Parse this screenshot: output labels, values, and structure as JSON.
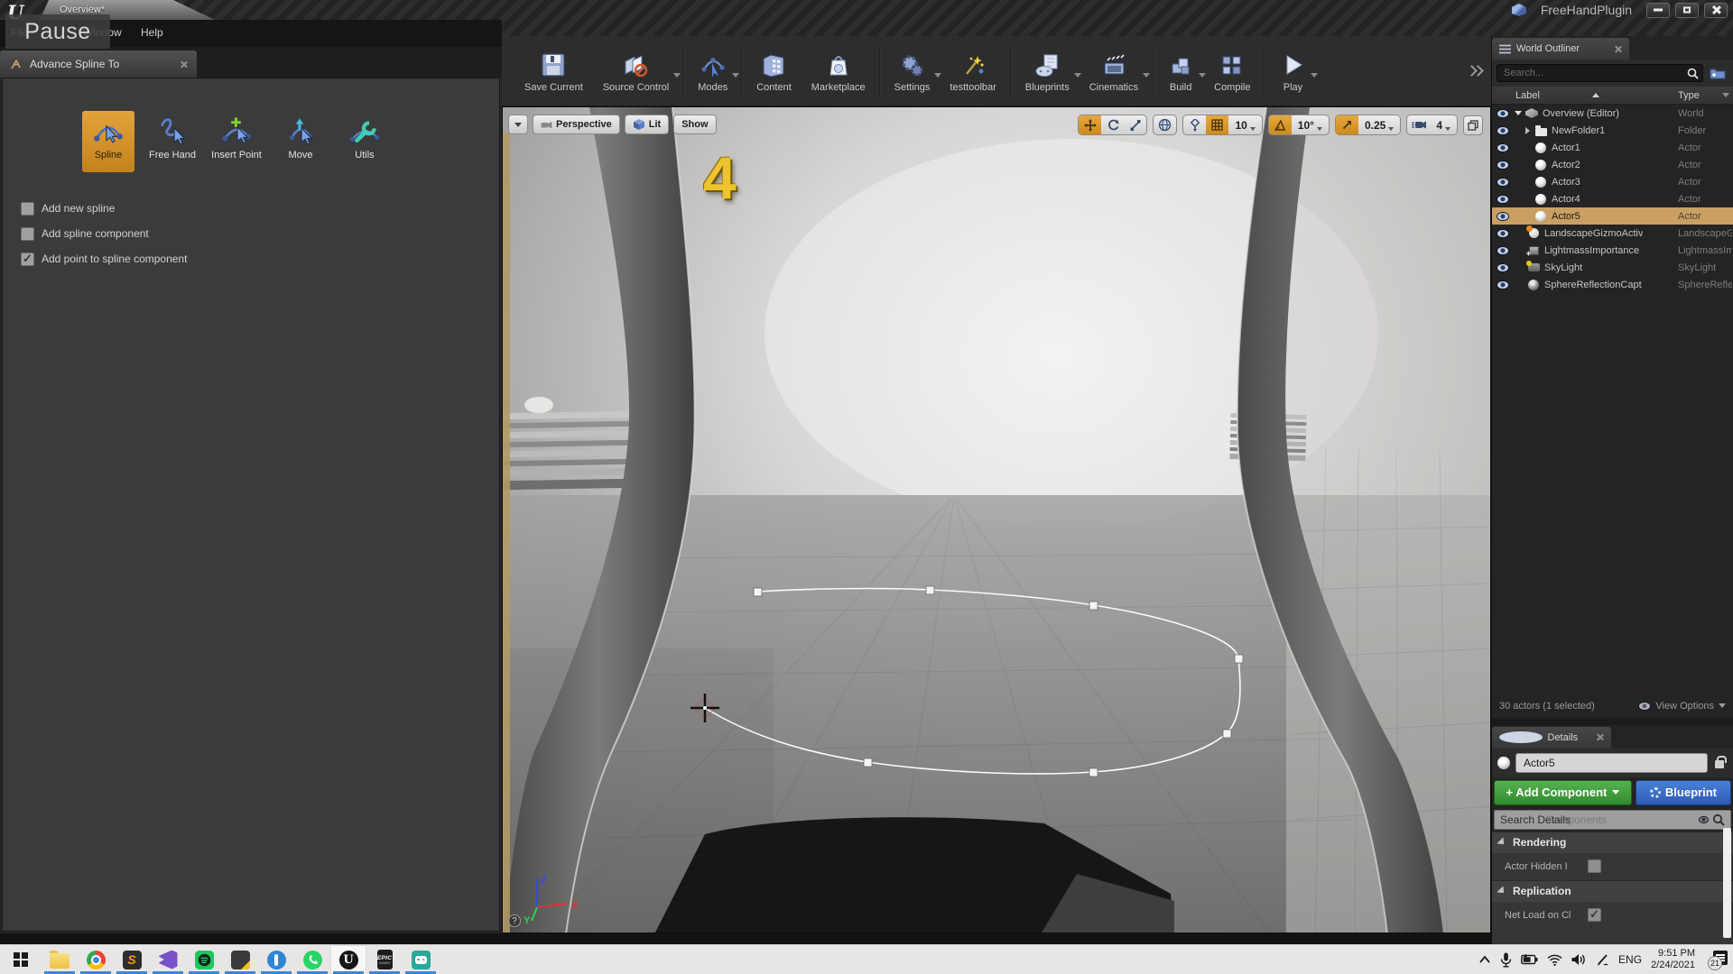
{
  "window": {
    "logo": "U",
    "tab": "Overview*",
    "menu": [
      "File",
      "Window",
      "Help"
    ],
    "pause": "Pause",
    "plugin_title": "FreeHandPlugin"
  },
  "plugin": {
    "tab": "Advance Spline To",
    "tools": [
      {
        "label": "Spline",
        "selected": true
      },
      {
        "label": "Free Hand",
        "selected": false
      },
      {
        "label": "Insert Point",
        "selected": false
      },
      {
        "label": "Move",
        "selected": false
      },
      {
        "label": "Utils",
        "selected": false
      }
    ],
    "options": [
      {
        "label": "Add new spline",
        "checked": false
      },
      {
        "label": "Add spline component",
        "checked": false
      },
      {
        "label": "Add point to spline component",
        "checked": true
      }
    ]
  },
  "toolbar": {
    "items": [
      {
        "label": "Save Current"
      },
      {
        "label": "Source Control"
      },
      {
        "label": "Modes"
      },
      {
        "label": "Content"
      },
      {
        "label": "Marketplace"
      },
      {
        "label": "Settings"
      },
      {
        "label": "testtoolbar"
      },
      {
        "label": "Blueprints"
      },
      {
        "label": "Cinematics"
      },
      {
        "label": "Build"
      },
      {
        "label": "Compile"
      },
      {
        "label": "Play"
      }
    ]
  },
  "viewport": {
    "camera": "Perspective",
    "lit": "Lit",
    "show": "Show",
    "overlay_number": "4",
    "grid_snap": "10",
    "rotation_snap": "10°",
    "scale_snap": "0.25",
    "camera_speed": "4",
    "help": "?",
    "axes": {
      "x": "X",
      "y": "Y",
      "z": "Z"
    }
  },
  "outliner": {
    "title": "World Outliner",
    "search_placeholder": "Search...",
    "col_label": "Label",
    "col_type": "Type",
    "rows": [
      {
        "label": "Overview (Editor)",
        "type": "World",
        "selected": false
      },
      {
        "label": "NewFolder1",
        "type": "Folder",
        "selected": false
      },
      {
        "label": "Actor1",
        "type": "Actor",
        "selected": false
      },
      {
        "label": "Actor2",
        "type": "Actor",
        "selected": false
      },
      {
        "label": "Actor3",
        "type": "Actor",
        "selected": false
      },
      {
        "label": "Actor4",
        "type": "Actor",
        "selected": false
      },
      {
        "label": "Actor5",
        "type": "Actor",
        "selected": true
      },
      {
        "label": "LandscapeGizmoActiv",
        "type": "LandscapeG",
        "selected": false
      },
      {
        "label": "LightmassImportance",
        "type": "LightmassIm",
        "selected": false
      },
      {
        "label": "SkyLight",
        "type": "SkyLight",
        "selected": false
      },
      {
        "label": "SphereReflectionCapt",
        "type": "SphereReflec",
        "selected": false
      }
    ],
    "footer": "30 actors (1 selected)",
    "view_options": "View Options"
  },
  "details": {
    "title": "Details",
    "actor_name": "Actor5",
    "add_component": "+ Add Component",
    "blueprint": "Blueprint",
    "search_text": "Search Details",
    "search_ghost": "Components",
    "sections": [
      {
        "title": "Rendering",
        "rows": [
          {
            "label": "Actor Hidden I",
            "checked": false
          }
        ]
      },
      {
        "title": "Replication",
        "rows": [
          {
            "label": "Net Load on Cl",
            "checked": true
          }
        ]
      }
    ]
  },
  "taskbar": {
    "sublime_letter": "S",
    "unreal_letter": "U",
    "epic_label": "EPIC",
    "epic_sub": "GAMES",
    "tray": {
      "language": "ENG",
      "time": "9:51 PM",
      "date": "2/24/2021",
      "notification_count": "21"
    }
  }
}
